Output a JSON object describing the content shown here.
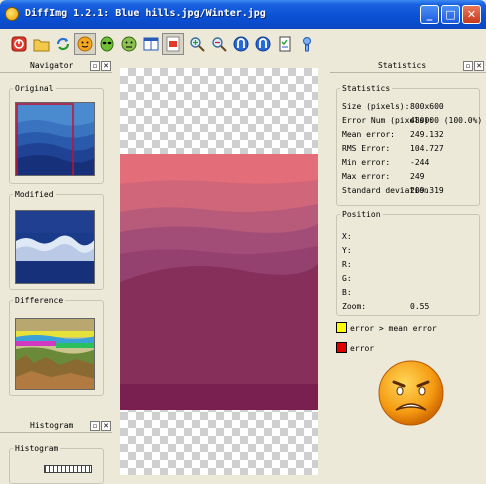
{
  "window": {
    "title": "DiffImg 1.2.1: Blue hills.jpg/Winter.jpg"
  },
  "titlebar_buttons": {
    "minimize": "_",
    "maximize": "□",
    "close": "✕"
  },
  "toolbar": {
    "icons": [
      "exit-icon",
      "open-folder-icon",
      "refresh-icon",
      "smiley-icon",
      "alien-icon",
      "face-icon",
      "split-view-icon",
      "mask-icon",
      "zoom-in-icon",
      "zoom-out-icon",
      "nav-prev-icon",
      "nav-next-icon",
      "checklist-icon",
      "info-icon"
    ]
  },
  "navigator": {
    "title": "Navigator",
    "original_label": "Original",
    "modified_label": "Modified",
    "difference_label": "Difference"
  },
  "histogram": {
    "title": "Histogram",
    "group_label": "Histogram"
  },
  "statistics": {
    "title": "Statistics",
    "group_label": "Statistics",
    "rows": [
      {
        "label": "Size (pixels):",
        "value": "800x600"
      },
      {
        "label": "Error Num (pixels):",
        "value": "480000 (100.0%)"
      },
      {
        "label": "Mean error:",
        "value": "249.132"
      },
      {
        "label": "RMS Error:",
        "value": "104.727"
      },
      {
        "label": "Min error:",
        "value": "-244"
      },
      {
        "label": "Max error:",
        "value": "249"
      },
      {
        "label": "Standard deviation",
        "value": "209.319"
      }
    ]
  },
  "position": {
    "group_label": "Position",
    "rows": [
      {
        "label": "X:",
        "value": ""
      },
      {
        "label": "Y:",
        "value": ""
      },
      {
        "label": "R:",
        "value": ""
      },
      {
        "label": "G:",
        "value": ""
      },
      {
        "label": "B:",
        "value": ""
      },
      {
        "label": "Zoom:",
        "value": "0.55"
      }
    ]
  },
  "legend": {
    "items": [
      {
        "label": "error > mean error",
        "color": "#ffff00"
      },
      {
        "label": "error",
        "color": "#e00000"
      }
    ]
  },
  "status_face": "sad-face-icon"
}
